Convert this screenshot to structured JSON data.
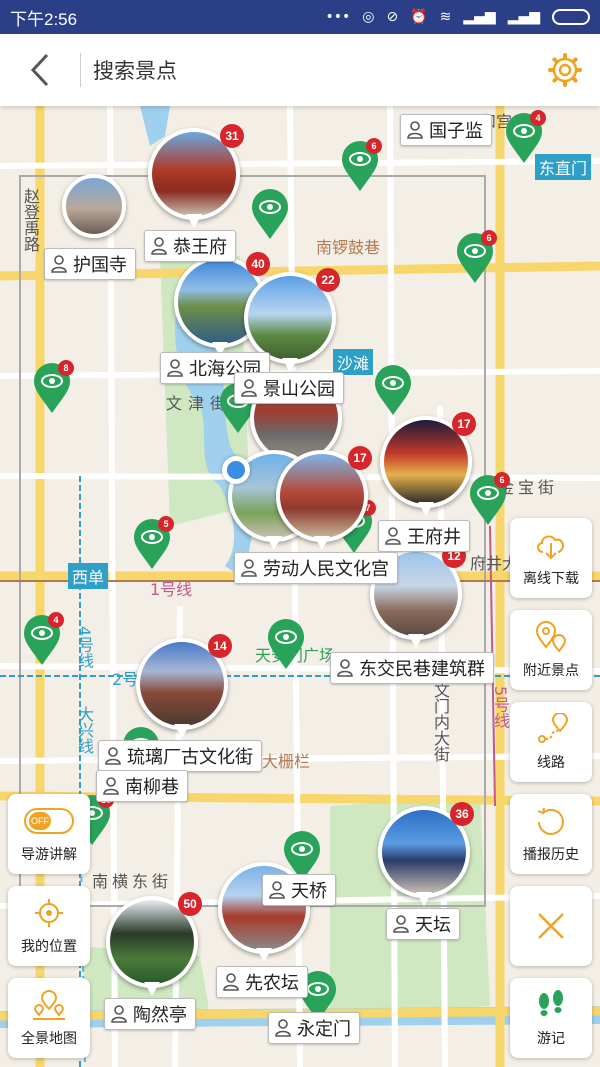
{
  "status_bar": {
    "time": "下午2:56",
    "icons": [
      "signal-dots-icon",
      "location-icon",
      "dnd-icon",
      "alarm-icon",
      "wifi-icon",
      "cell-signal-icon",
      "cell-signal-icon",
      "battery-icon"
    ]
  },
  "header": {
    "title": "搜索景点",
    "back_icon": "chevron-left-icon",
    "settings_icon": "gear-icon",
    "accent": "#f0a322"
  },
  "colors": {
    "pin_green": "#2aa35a",
    "badge_red": "#d6262b",
    "metro_blue": "#2ea0c8",
    "road_yellow": "#f7d66b",
    "water": "#9fd1ee",
    "park": "#cfe8c2"
  },
  "spots": [
    {
      "name": "国子监"
    },
    {
      "name": "恭王府",
      "count": "31"
    },
    {
      "name": "护国寺"
    },
    {
      "name": "北海公园",
      "count": "40"
    },
    {
      "name": "景山公园",
      "count": "22"
    },
    {
      "name": "王府井",
      "count": "17"
    },
    {
      "name": "劳动人民文化宫",
      "count": "17"
    },
    {
      "name": "东交民巷建筑群",
      "count": "12"
    },
    {
      "name": "琉璃厂古文化街",
      "count": "14"
    },
    {
      "name": "南柳巷"
    },
    {
      "name": "天坛",
      "count": "36"
    },
    {
      "name": "天桥"
    },
    {
      "name": "先农坛"
    },
    {
      "name": "陶然亭",
      "count": "50"
    },
    {
      "name": "永定门"
    }
  ],
  "green_pins": [
    {
      "count": "6"
    },
    {
      "count": "6"
    },
    {
      "count": "8"
    },
    {
      "count": "6"
    },
    {
      "count": "5"
    },
    {
      "count": "7"
    },
    {
      "count": "4"
    },
    {
      "count": "10"
    },
    {
      "count": "4"
    }
  ],
  "map_labels": {
    "dongzhimen": "东直门",
    "nanluoguxiang": "南锣鼓巷",
    "shatan": "沙滩",
    "xidan": "西单",
    "jinbaojie": "金宝街",
    "wenjin": "文津街",
    "hepingmen_line": "1号线",
    "line2": "2号线",
    "line4": "4号线",
    "line5": "5号线",
    "daxing": "大兴线",
    "nanhengdongjie": "南横东街",
    "zhaodenglu": "赵登禹路",
    "tiananmen": "天安门广场",
    "dashilan": "大栅栏",
    "chongwenmen": "崇文门内大街",
    "yonghegong": "和宫",
    "fujing": "府井大街"
  },
  "side_left": [
    {
      "label": "导游讲解",
      "icon": "toggle-off-icon",
      "toggle_text": "OFF"
    },
    {
      "label": "我的位置",
      "icon": "crosshair-icon"
    },
    {
      "label": "全景地图",
      "icon": "map-pins-icon"
    }
  ],
  "side_right": [
    {
      "label": "离线下载",
      "icon": "cloud-download-icon"
    },
    {
      "label": "附近景点",
      "icon": "nearby-pin-icon"
    },
    {
      "label": "线路",
      "icon": "route-icon"
    },
    {
      "label": "播报历史",
      "icon": "history-icon"
    },
    {
      "label": "",
      "icon": "close-icon"
    },
    {
      "label": "游记",
      "icon": "footprints-icon"
    }
  ]
}
